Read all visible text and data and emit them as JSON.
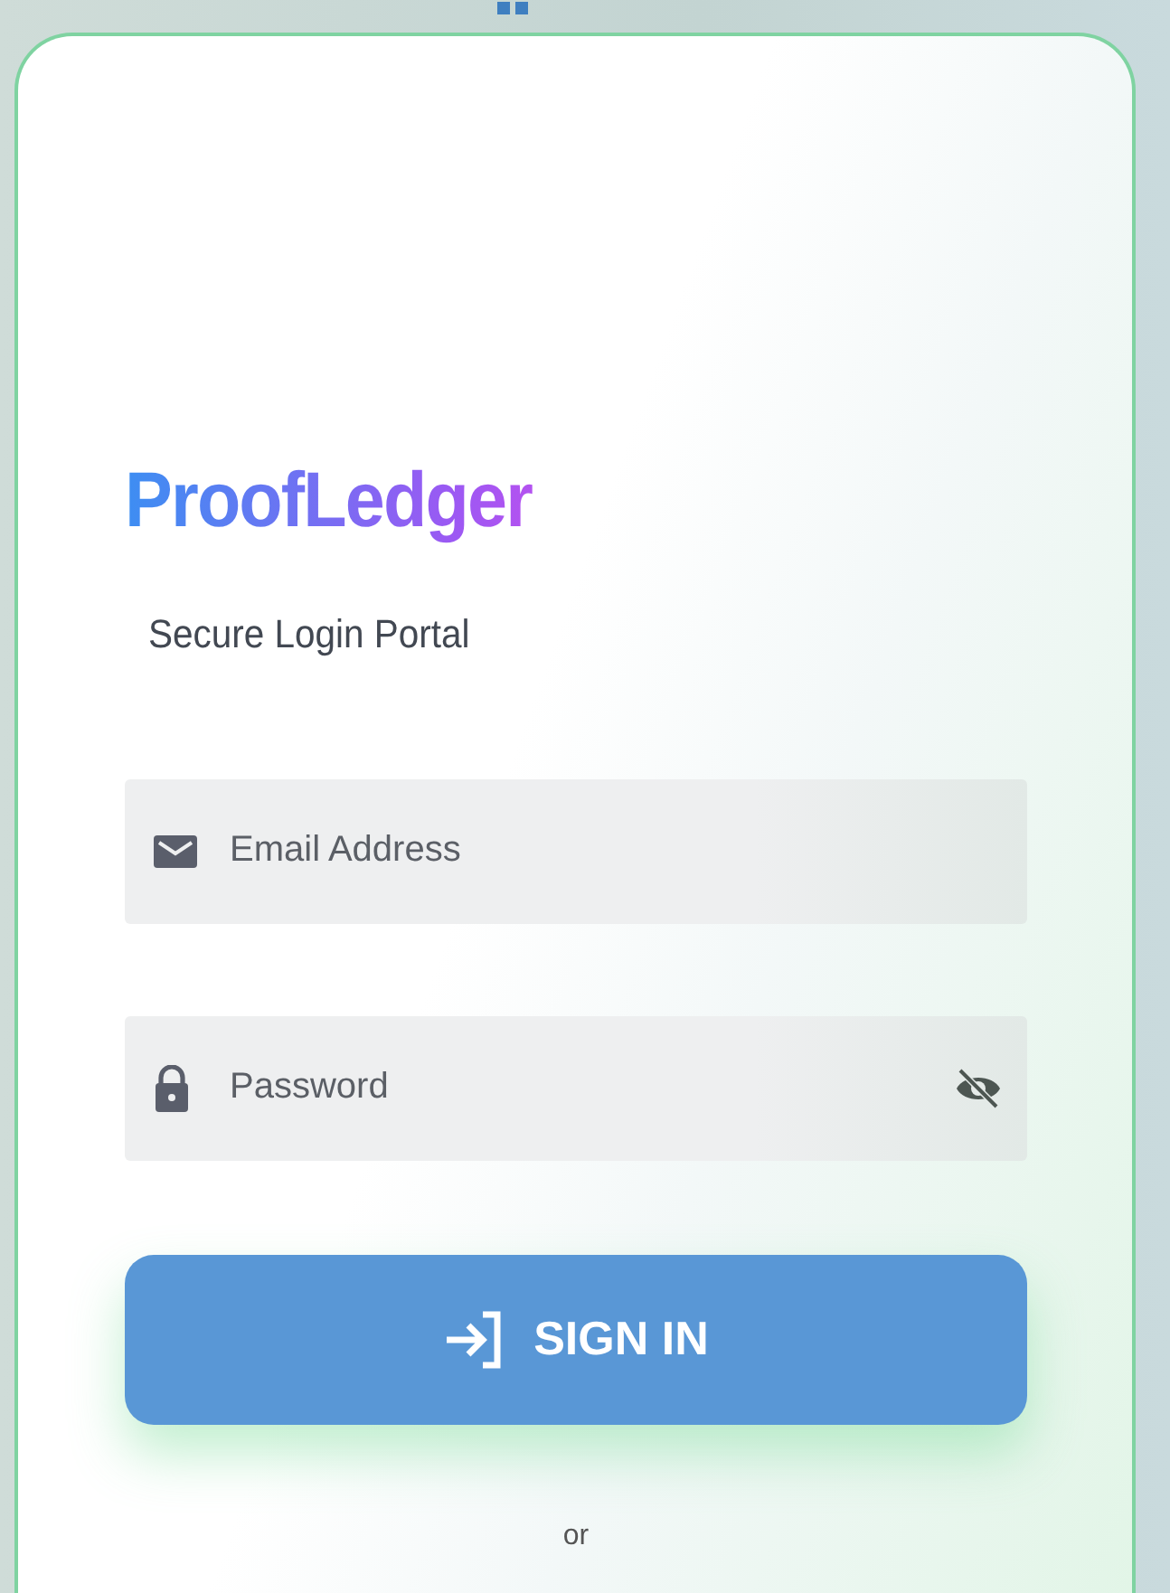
{
  "brand": {
    "name": "ProofLedger"
  },
  "subtitle": "Secure Login Portal",
  "fields": [
    {
      "kind": "email",
      "placeholder": "Email Address"
    },
    {
      "kind": "password",
      "placeholder": "Password"
    }
  ],
  "submit": {
    "label": "SIGN IN"
  },
  "divider": "or"
}
